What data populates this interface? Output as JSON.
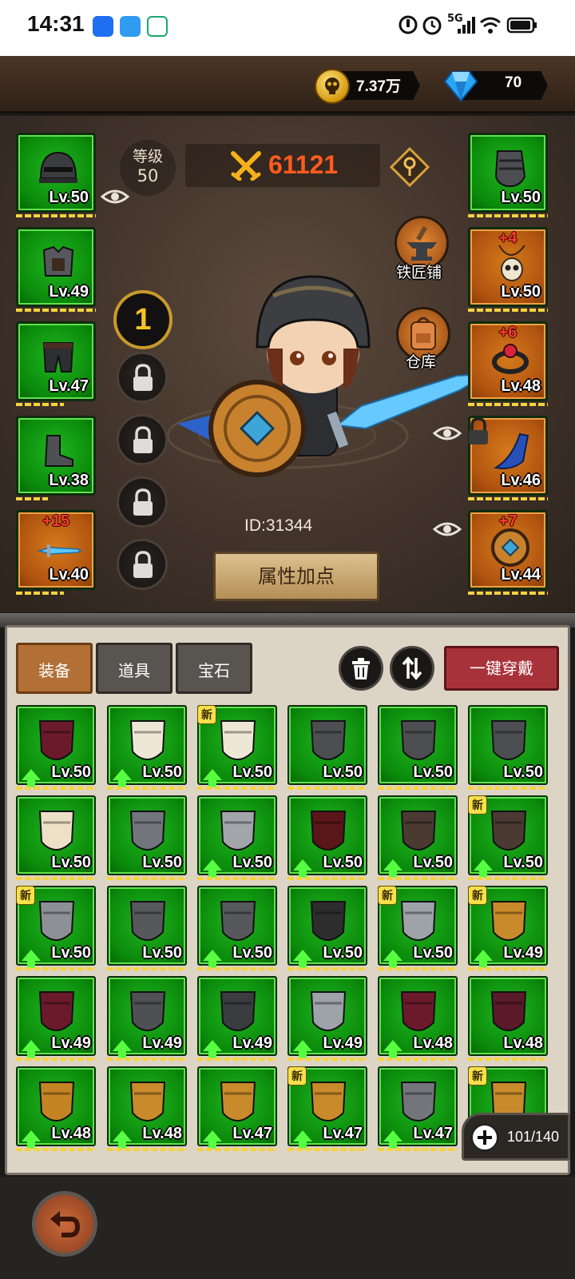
{
  "status_bar": {
    "time": "14:31",
    "network": "5G",
    "battery": "battery"
  },
  "currency": {
    "gold": "7.37万",
    "gems": "70",
    "gold_icon": "skull-coin-icon",
    "gem_icon": "blue-gem-icon"
  },
  "hero": {
    "level_label": "等级",
    "level_value": "50",
    "power": "61121",
    "id": "ID:31344",
    "preset_number": "1",
    "attribute_button": "属性加点",
    "blacksmith_label": "铁匠铺",
    "warehouse_label": "仓库"
  },
  "equip_left": [
    {
      "item": "helmet",
      "level": "Lv.50",
      "plus": ""
    },
    {
      "item": "chest-armor",
      "level": "Lv.49",
      "plus": ""
    },
    {
      "item": "pants",
      "level": "Lv.47",
      "plus": ""
    },
    {
      "item": "boots",
      "level": "Lv.38",
      "plus": ""
    },
    {
      "item": "ice-sword",
      "level": "Lv.40",
      "plus": "+15"
    }
  ],
  "equip_right": [
    {
      "item": "gauntlets",
      "level": "Lv.50",
      "plus": ""
    },
    {
      "item": "skull-necklace",
      "level": "Lv.50",
      "plus": "+4"
    },
    {
      "item": "ring",
      "level": "Lv.48",
      "plus": "+6"
    },
    {
      "item": "cape",
      "level": "Lv.46",
      "plus": ""
    },
    {
      "item": "shield",
      "level": "Lv.44",
      "plus": "+7"
    }
  ],
  "tabs": [
    "装备",
    "道具",
    "宝石"
  ],
  "wear_all_button": "一键穿戴",
  "inventory_capacity": "101/140",
  "new_badge": "新",
  "inventory": [
    {
      "item": "maroon-pants",
      "level": "Lv.50",
      "up": true,
      "new": false
    },
    {
      "item": "white-pants",
      "level": "Lv.50",
      "up": true,
      "new": false
    },
    {
      "item": "white-pants",
      "level": "Lv.50",
      "up": true,
      "new": true
    },
    {
      "item": "gauntlets",
      "level": "Lv.50",
      "up": false,
      "new": false
    },
    {
      "item": "gauntlets",
      "level": "Lv.50",
      "up": false,
      "new": false
    },
    {
      "item": "gauntlets",
      "level": "Lv.50",
      "up": false,
      "new": false
    },
    {
      "item": "white-chest",
      "level": "Lv.50",
      "up": false,
      "new": false
    },
    {
      "item": "pauldron",
      "level": "Lv.50",
      "up": false,
      "new": false
    },
    {
      "item": "silver-boots",
      "level": "Lv.50",
      "up": true,
      "new": false
    },
    {
      "item": "red-boots",
      "level": "Lv.50",
      "up": true,
      "new": false
    },
    {
      "item": "spiked-helmet",
      "level": "Lv.50",
      "up": true,
      "new": false
    },
    {
      "item": "spiked-helmet",
      "level": "Lv.50",
      "up": true,
      "new": true
    },
    {
      "item": "silver-helmet",
      "level": "Lv.50",
      "up": true,
      "new": true
    },
    {
      "item": "chest-armor",
      "level": "Lv.50",
      "up": false,
      "new": false
    },
    {
      "item": "chest-armor",
      "level": "Lv.50",
      "up": true,
      "new": false
    },
    {
      "item": "skull-armor",
      "level": "Lv.50",
      "up": true,
      "new": false
    },
    {
      "item": "silver-chest",
      "level": "Lv.50",
      "up": true,
      "new": true
    },
    {
      "item": "gold-pants",
      "level": "Lv.49",
      "up": true,
      "new": true
    },
    {
      "item": "maroon-pants",
      "level": "Lv.49",
      "up": true,
      "new": false
    },
    {
      "item": "boots",
      "level": "Lv.49",
      "up": true,
      "new": false
    },
    {
      "item": "helmet",
      "level": "Lv.49",
      "up": true,
      "new": false
    },
    {
      "item": "silver-chest",
      "level": "Lv.49",
      "up": true,
      "new": false
    },
    {
      "item": "maroon-pants",
      "level": "Lv.48",
      "up": true,
      "new": false
    },
    {
      "item": "maroon-bracer",
      "level": "Lv.48",
      "up": false,
      "new": false
    },
    {
      "item": "gold-boots",
      "level": "Lv.48",
      "up": true,
      "new": false
    },
    {
      "item": "gold-gauntlet",
      "level": "Lv.48",
      "up": true,
      "new": false
    },
    {
      "item": "gold-pants",
      "level": "Lv.47",
      "up": true,
      "new": false
    },
    {
      "item": "gold-pants",
      "level": "Lv.47",
      "up": true,
      "new": true
    },
    {
      "item": "pauldron",
      "level": "Lv.47",
      "up": true,
      "new": false
    },
    {
      "item": "gold-gauntlet",
      "level": "Lv.47",
      "up": true,
      "new": true
    }
  ],
  "back_button_icon": "back-arrow-icon",
  "colors": {
    "slot_green": "#0b8a0b",
    "slot_orange": "#b05310",
    "power": "#ff5b1f",
    "wear_all": "#a8323a"
  }
}
